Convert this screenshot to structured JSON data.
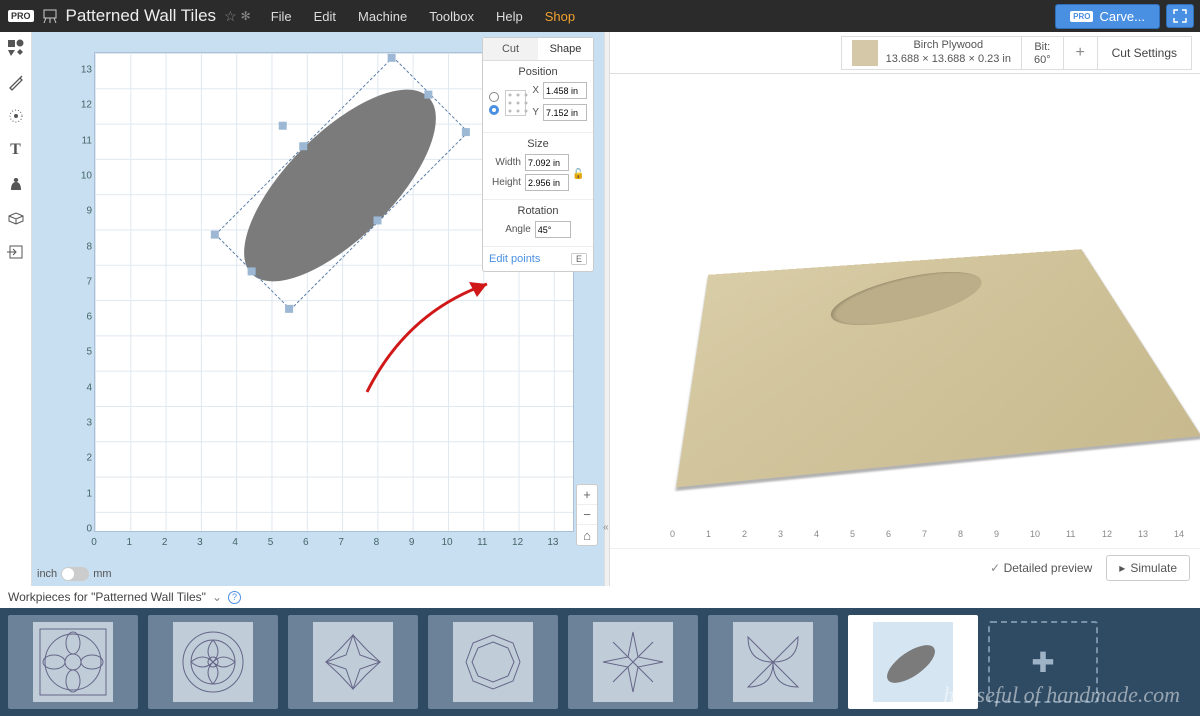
{
  "header": {
    "pro_badge": "PRO",
    "title": "Patterned Wall Tiles",
    "menus": [
      "File",
      "Edit",
      "Machine",
      "Toolbox",
      "Help",
      "Shop"
    ],
    "carve_pro": "PRO",
    "carve_label": "Carve..."
  },
  "shape_panel": {
    "tab_cut": "Cut",
    "tab_shape": "Shape",
    "position_title": "Position",
    "x_label": "X",
    "x_value": "1.458 in",
    "y_label": "Y",
    "y_value": "7.152 in",
    "size_title": "Size",
    "width_label": "Width",
    "width_value": "7.092 in",
    "height_label": "Height",
    "height_value": "2.956 in",
    "rotation_title": "Rotation",
    "angle_label": "Angle",
    "angle_value": "45°",
    "edit_points": "Edit points",
    "edit_key": "E"
  },
  "canvas": {
    "ruler_y": [
      "13",
      "12",
      "11",
      "10",
      "9",
      "8",
      "7",
      "6",
      "5",
      "4",
      "3",
      "2",
      "1",
      "0"
    ],
    "ruler_x": [
      "0",
      "1",
      "2",
      "3",
      "4",
      "5",
      "6",
      "7",
      "8",
      "9",
      "10",
      "11",
      "12",
      "13"
    ],
    "unit_inch": "inch",
    "unit_mm": "mm"
  },
  "preview": {
    "material_name": "Birch Plywood",
    "material_dims": "13.688 × 13.688 × 0.23 in",
    "bit_label": "Bit:",
    "bit_value": "60°",
    "cut_settings": "Cut Settings",
    "axis_ticks": [
      "0",
      "1",
      "2",
      "3",
      "4",
      "5",
      "6",
      "7",
      "8",
      "9",
      "10",
      "11",
      "12",
      "13",
      "14"
    ],
    "detailed": "Detailed preview",
    "simulate": "Simulate"
  },
  "workpieces": {
    "label": "Workpieces for \"Patterned Wall Tiles\"",
    "help": "?"
  },
  "watermark": "houseful of handmade.com"
}
